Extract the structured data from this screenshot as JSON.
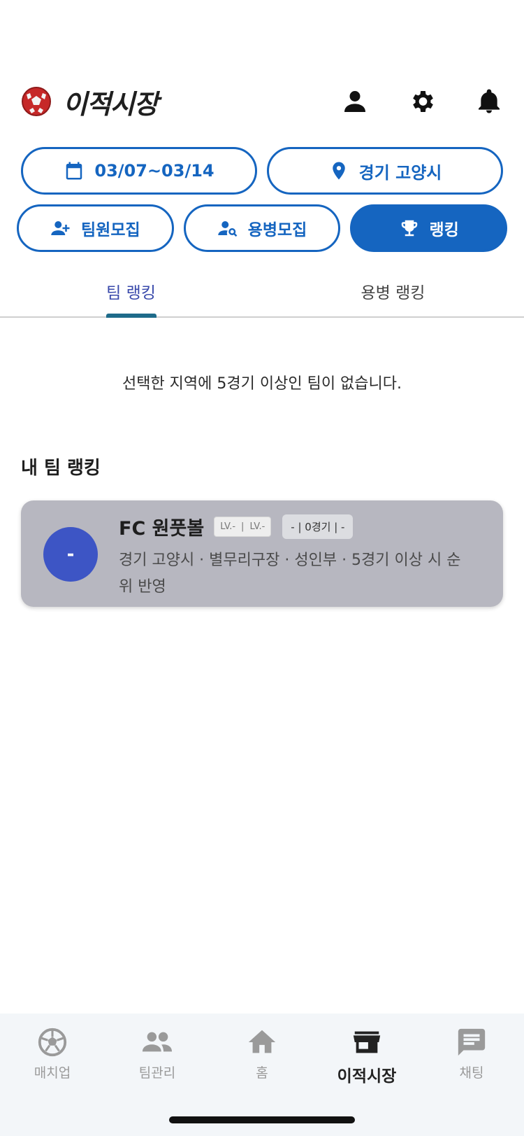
{
  "header": {
    "title": "이적시장",
    "icons": [
      "profile-icon",
      "gear-icon",
      "bell-icon"
    ]
  },
  "filters": {
    "date_range": "03/07~03/14",
    "location": "경기 고양시"
  },
  "categories": {
    "recruit_member": "팀원모집",
    "recruit_mercenary": "용병모집",
    "ranking": "랭킹"
  },
  "tabs": [
    {
      "label": "팀 랭킹",
      "selected": true
    },
    {
      "label": "용병 랭킹",
      "selected": false
    }
  ],
  "empty_message": "선택한 지역에 5경기 이상인 팀이 없습니다.",
  "my_team_section": {
    "title": "내 팀 랭킹",
    "team": {
      "rank": "-",
      "name": "FC 원풋볼",
      "level_1": "LV.-",
      "level_sep": "|",
      "level_2": "LV.-",
      "record": "- | 0경기 | -",
      "description": "경기 고양시 · 별무리구장 · 성인부 · 5경기 이상 시 순위 반영"
    }
  },
  "bottom_nav": [
    {
      "label": "매치업",
      "icon": "soccer-ball-icon"
    },
    {
      "label": "팀관리",
      "icon": "people-icon"
    },
    {
      "label": "홈",
      "icon": "home-icon"
    },
    {
      "label": "이적시장",
      "icon": "store-icon",
      "active": true
    },
    {
      "label": "채팅",
      "icon": "chat-icon"
    }
  ],
  "colors": {
    "primary": "#1565c0",
    "tab_selected": "#3949ab",
    "card_bg": "#b7b7c0",
    "avatar_bg": "#3d55c5"
  }
}
